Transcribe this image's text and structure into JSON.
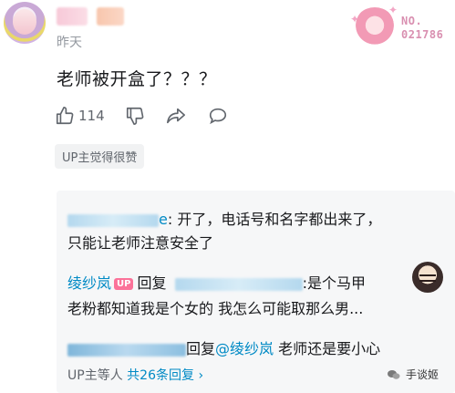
{
  "header": {
    "date": "昨天",
    "badge_number_line1": "NO.",
    "badge_number_line2": "021786"
  },
  "comment": {
    "text": "老师被开盒了？？？",
    "likes": "114",
    "up_liked_label": "UP主觉得很赞"
  },
  "replies": [
    {
      "name_suffix": "e",
      "text": ": 开了，电话号和名字都出来了，",
      "text_cont": "只能让老师注意安全了"
    },
    {
      "author": "绫纱岚",
      "up_tag": "UP",
      "reply_word": "回复",
      "text": ":是个马甲",
      "text_cont": "老粉都知道我是个女的    我怎么可能取那么男..."
    },
    {
      "reply_word": "回复",
      "mention": "@绫纱岚",
      "text": " 老师还是要小心"
    }
  ],
  "summary": {
    "prefix": "UP主等人",
    "count": "共26条回复",
    "chevron": "›"
  },
  "watermark": {
    "text": "手谈姬"
  }
}
